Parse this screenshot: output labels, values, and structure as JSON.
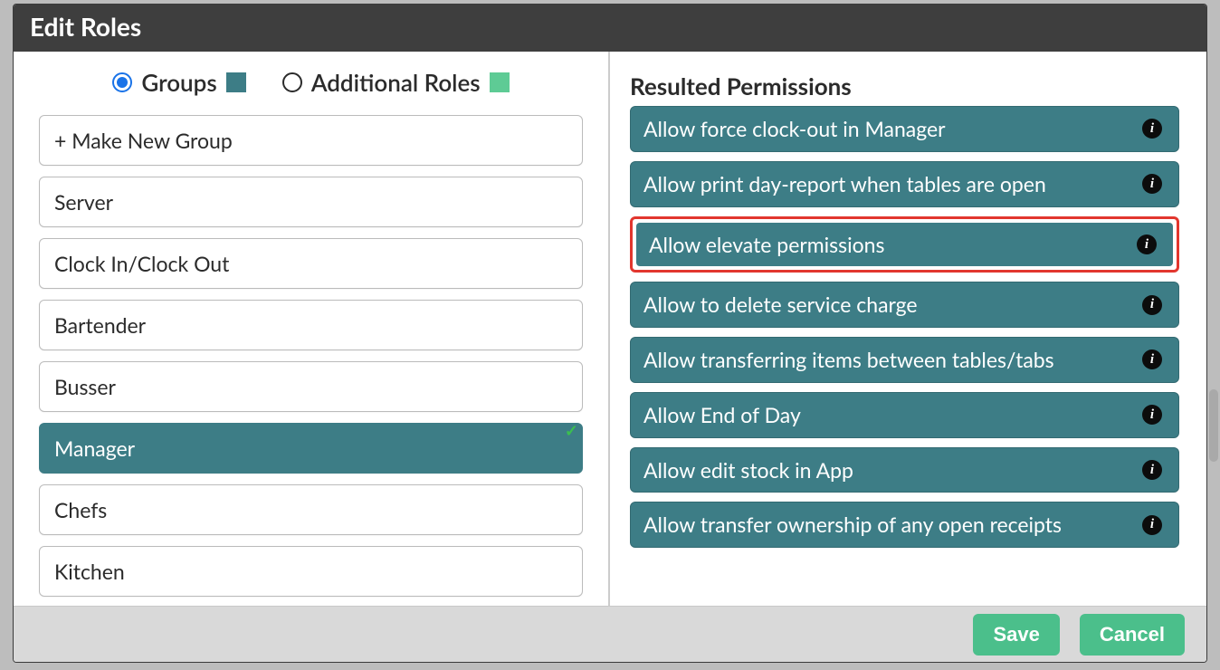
{
  "colors": {
    "groups_swatch": "#3d7d86",
    "additional_swatch": "#5ecb95",
    "perm_bg": "#3d7d86",
    "highlight_border": "#e2362e"
  },
  "header": {
    "title": "Edit Roles"
  },
  "radios": {
    "groups_label": "Groups",
    "additional_label": "Additional Roles",
    "selected": "groups"
  },
  "left": {
    "make_new": "+ Make New Group",
    "items": [
      {
        "label": "Server",
        "selected": false
      },
      {
        "label": "Clock In/Clock Out",
        "selected": false
      },
      {
        "label": "Bartender",
        "selected": false
      },
      {
        "label": "Busser",
        "selected": false
      },
      {
        "label": "Manager",
        "selected": true
      },
      {
        "label": "Chefs",
        "selected": false
      },
      {
        "label": "Kitchen",
        "selected": false
      }
    ]
  },
  "right": {
    "title": "Resulted Permissions",
    "permissions": [
      {
        "label": "Allow force clock-out in Manager",
        "highlighted": false
      },
      {
        "label": "Allow print day-report when tables are open",
        "highlighted": false
      },
      {
        "label": "Allow elevate permissions",
        "highlighted": true
      },
      {
        "label": "Allow to delete service charge",
        "highlighted": false
      },
      {
        "label": "Allow transferring items between tables/tabs",
        "highlighted": false
      },
      {
        "label": "Allow End of Day",
        "highlighted": false
      },
      {
        "label": "Allow edit stock in App",
        "highlighted": false
      },
      {
        "label": "Allow transfer ownership of any open receipts",
        "highlighted": false
      }
    ]
  },
  "footer": {
    "save_label": "Save",
    "cancel_label": "Cancel"
  }
}
